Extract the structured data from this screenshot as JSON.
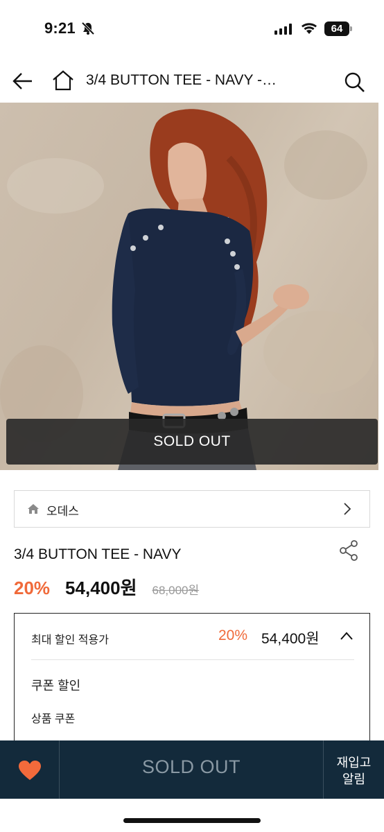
{
  "status": {
    "time": "9:21",
    "battery": "64"
  },
  "header": {
    "title": "3/4 BUTTON TEE - NAVY -…"
  },
  "hero": {
    "sold_out_label": "SOLD OUT"
  },
  "brand": {
    "name": "오데스"
  },
  "product": {
    "title": "3/4 BUTTON TEE - NAVY",
    "discount_rate": "20%",
    "price": "54,400원",
    "original_price": "68,000원"
  },
  "discount_box": {
    "max_label": "최대 할인 적용가",
    "max_discount": "20%",
    "max_price": "54,400원",
    "coupon_label": "쿠폰 할인",
    "product_coupon_label": "상품 쿠폰"
  },
  "bottom_bar": {
    "buy_label": "SOLD OUT",
    "restock_line1": "재입고",
    "restock_line2": "알림"
  },
  "colors": {
    "accent": "#f06a3a",
    "bottom_bar": "#132a3b",
    "heart": "#f26a3b"
  }
}
